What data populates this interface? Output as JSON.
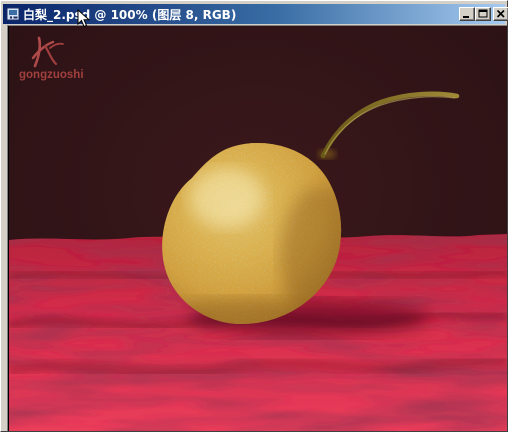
{
  "window": {
    "title": "白梨_2.psd @ 100% (图层 8, RGB)",
    "document_icon": "photoshop-document-icon",
    "controls": {
      "minimize": "minimize-icon",
      "maximize": "maximize-icon",
      "close": "close-icon"
    }
  },
  "canvas": {
    "watermark": {
      "text": "gongzuoshi",
      "logo_icon": "calligraphy-logo-icon"
    },
    "colors": {
      "background": "#2e1316",
      "cloth": "#c81840",
      "pear": "#e8c45a",
      "title_bar": "#0a246a"
    }
  },
  "cursor": "arrow-cursor-icon"
}
